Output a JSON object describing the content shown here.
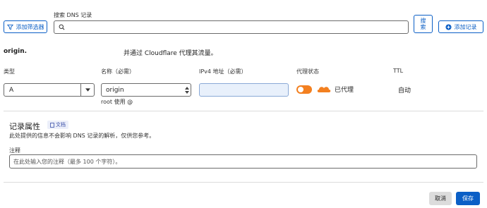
{
  "toolbar": {
    "filter_button_label": "添加筛选器",
    "search_label": "搜索 DNS 记录",
    "search_placeholder": "",
    "search_button_label": "搜索",
    "add_record_label": "添加记录"
  },
  "record": {
    "zone_name": "origin.",
    "proxy_note": "并通过 Cloudflare 代理其流量。",
    "type_label": "类型",
    "type_value": "A",
    "name_label": "名称（必需）",
    "name_value": "origin",
    "name_hint": "root 使用 @",
    "ipv4_label": "IPv4 地址（必需）",
    "ipv4_value": "",
    "proxy_label": "代理状态",
    "proxy_status": "已代理",
    "ttl_label": "TTL",
    "ttl_value": "自动"
  },
  "attributes": {
    "title": "记录属性",
    "docs_label": "文档",
    "description": "此处提供的信息不会影响 DNS 记录的解析，仅供您参考。",
    "comment_label": "注释",
    "comment_placeholder": "在此处输入您的注释（最多 100 个字符）。"
  },
  "footer": {
    "cancel_label": "取消",
    "save_label": "保存"
  },
  "colors": {
    "accent": "#0b5fc6",
    "toggle": "#f38020",
    "ipv4_fill": "#e8f0fb"
  }
}
